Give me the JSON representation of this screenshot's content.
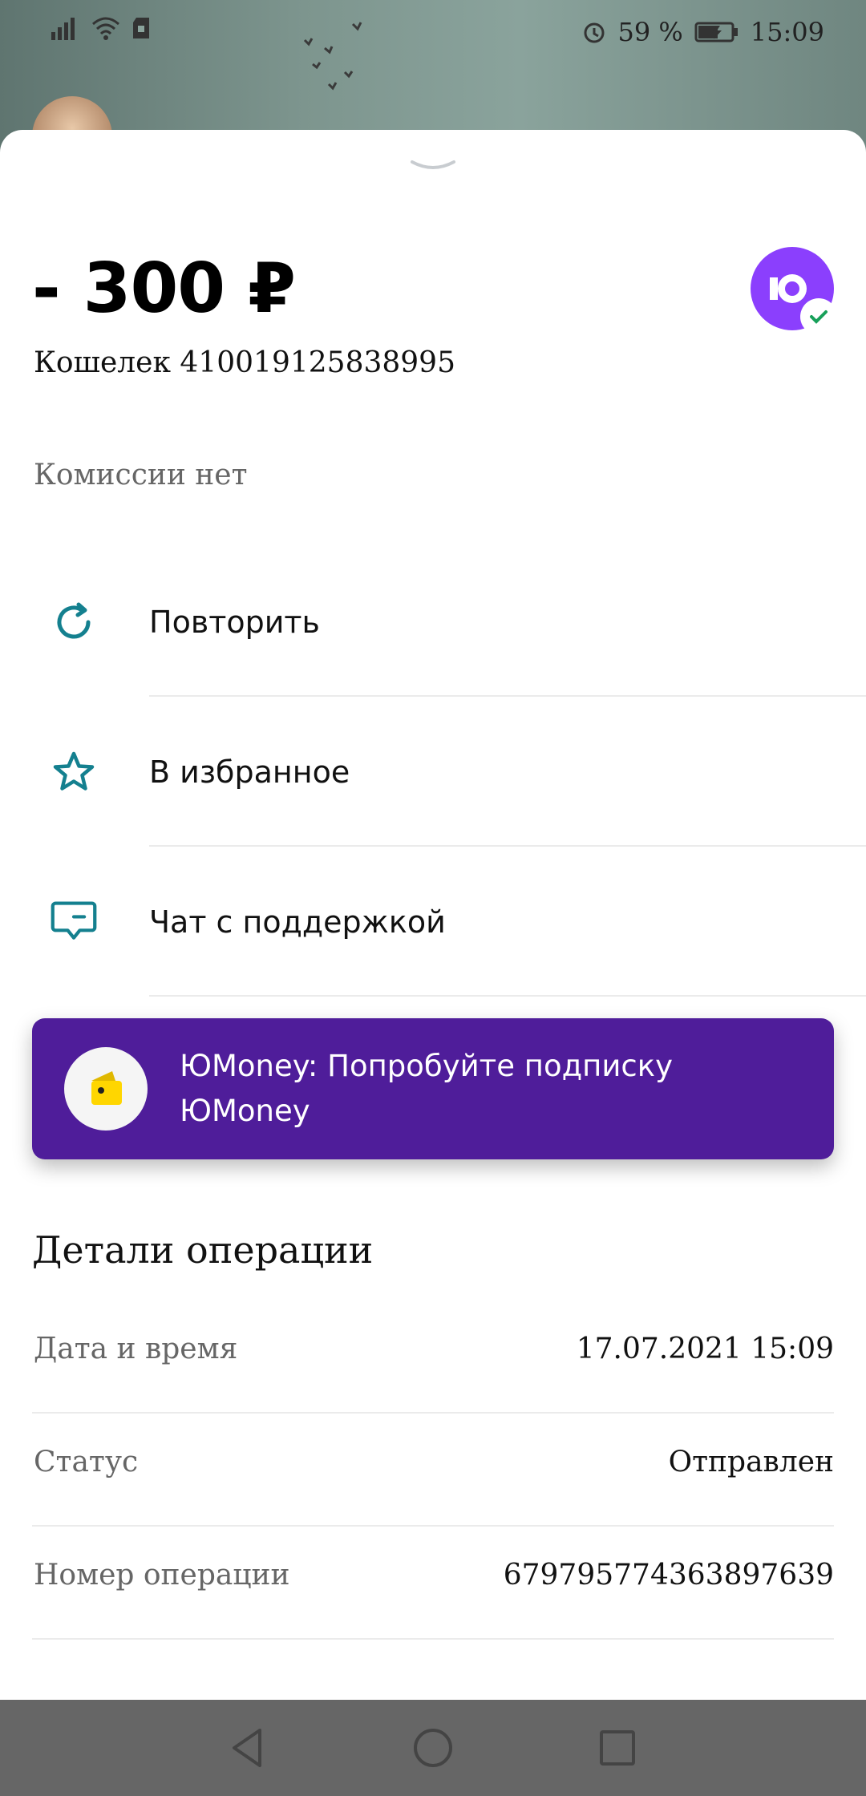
{
  "status_bar": {
    "battery": "59 %",
    "time": "15:09"
  },
  "transaction": {
    "amount": "- 300 ₽",
    "wallet": "Кошелек 410019125838995",
    "fee": "Комиссии нет"
  },
  "actions": [
    {
      "label": "Повторить",
      "icon": "refresh-icon"
    },
    {
      "label": "В избранное",
      "icon": "star-icon"
    },
    {
      "label": "Чат с поддержкой",
      "icon": "chat-icon"
    }
  ],
  "promo": {
    "text": "ЮMoney: Попробуйте подписку ЮMoney"
  },
  "details": {
    "title": "Детали операции",
    "rows": [
      {
        "label": "Дата и время",
        "value": "17.07.2021 15:09"
      },
      {
        "label": "Статус",
        "value": "Отправлен"
      },
      {
        "label": "Номер операции",
        "value": "679795774363897639"
      }
    ]
  },
  "colors": {
    "accent": "#14808f",
    "brand": "#8b3ffd",
    "promo_bg": "#4f1d9a",
    "nav_bg": "#666666"
  }
}
